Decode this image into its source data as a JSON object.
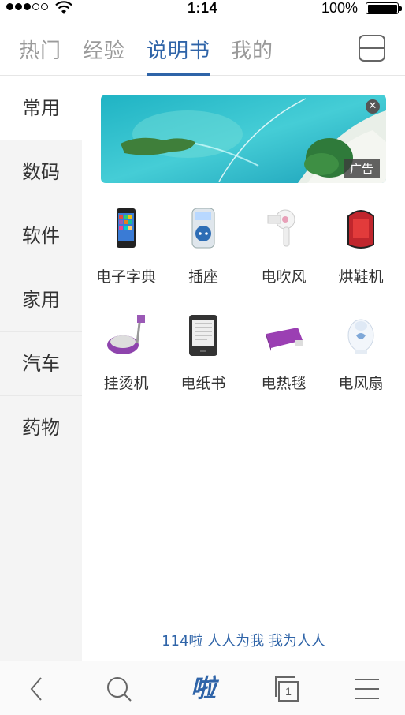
{
  "status_bar": {
    "time": "1:14",
    "battery": "100%"
  },
  "tabs": [
    {
      "label": "热门"
    },
    {
      "label": "经验"
    },
    {
      "label": "说明书"
    },
    {
      "label": "我的"
    }
  ],
  "sidebar": {
    "items": [
      {
        "label": "常用"
      },
      {
        "label": "数码"
      },
      {
        "label": "软件"
      },
      {
        "label": "家用"
      },
      {
        "label": "汽车"
      },
      {
        "label": "药物"
      }
    ]
  },
  "banner": {
    "ad_label": "广告"
  },
  "products": [
    {
      "label": "电子字典",
      "icon": "phone-icon"
    },
    {
      "label": "插座",
      "icon": "socket-icon"
    },
    {
      "label": "电吹风",
      "icon": "hairdryer-icon"
    },
    {
      "label": "烘鞋机",
      "icon": "shoe-dryer-icon"
    },
    {
      "label": "挂烫机",
      "icon": "steamer-icon"
    },
    {
      "label": "电纸书",
      "icon": "ereader-icon"
    },
    {
      "label": "电热毯",
      "icon": "electric-blanket-icon"
    },
    {
      "label": "电风扇",
      "icon": "fan-icon"
    }
  ],
  "slogan": "114啦 人人为我 我为人人",
  "toolbar": {
    "logo_text": "啦",
    "tab_count": "1"
  },
  "colors": {
    "accent": "#2f64a8",
    "sidebar_bg": "#f4f4f4"
  }
}
